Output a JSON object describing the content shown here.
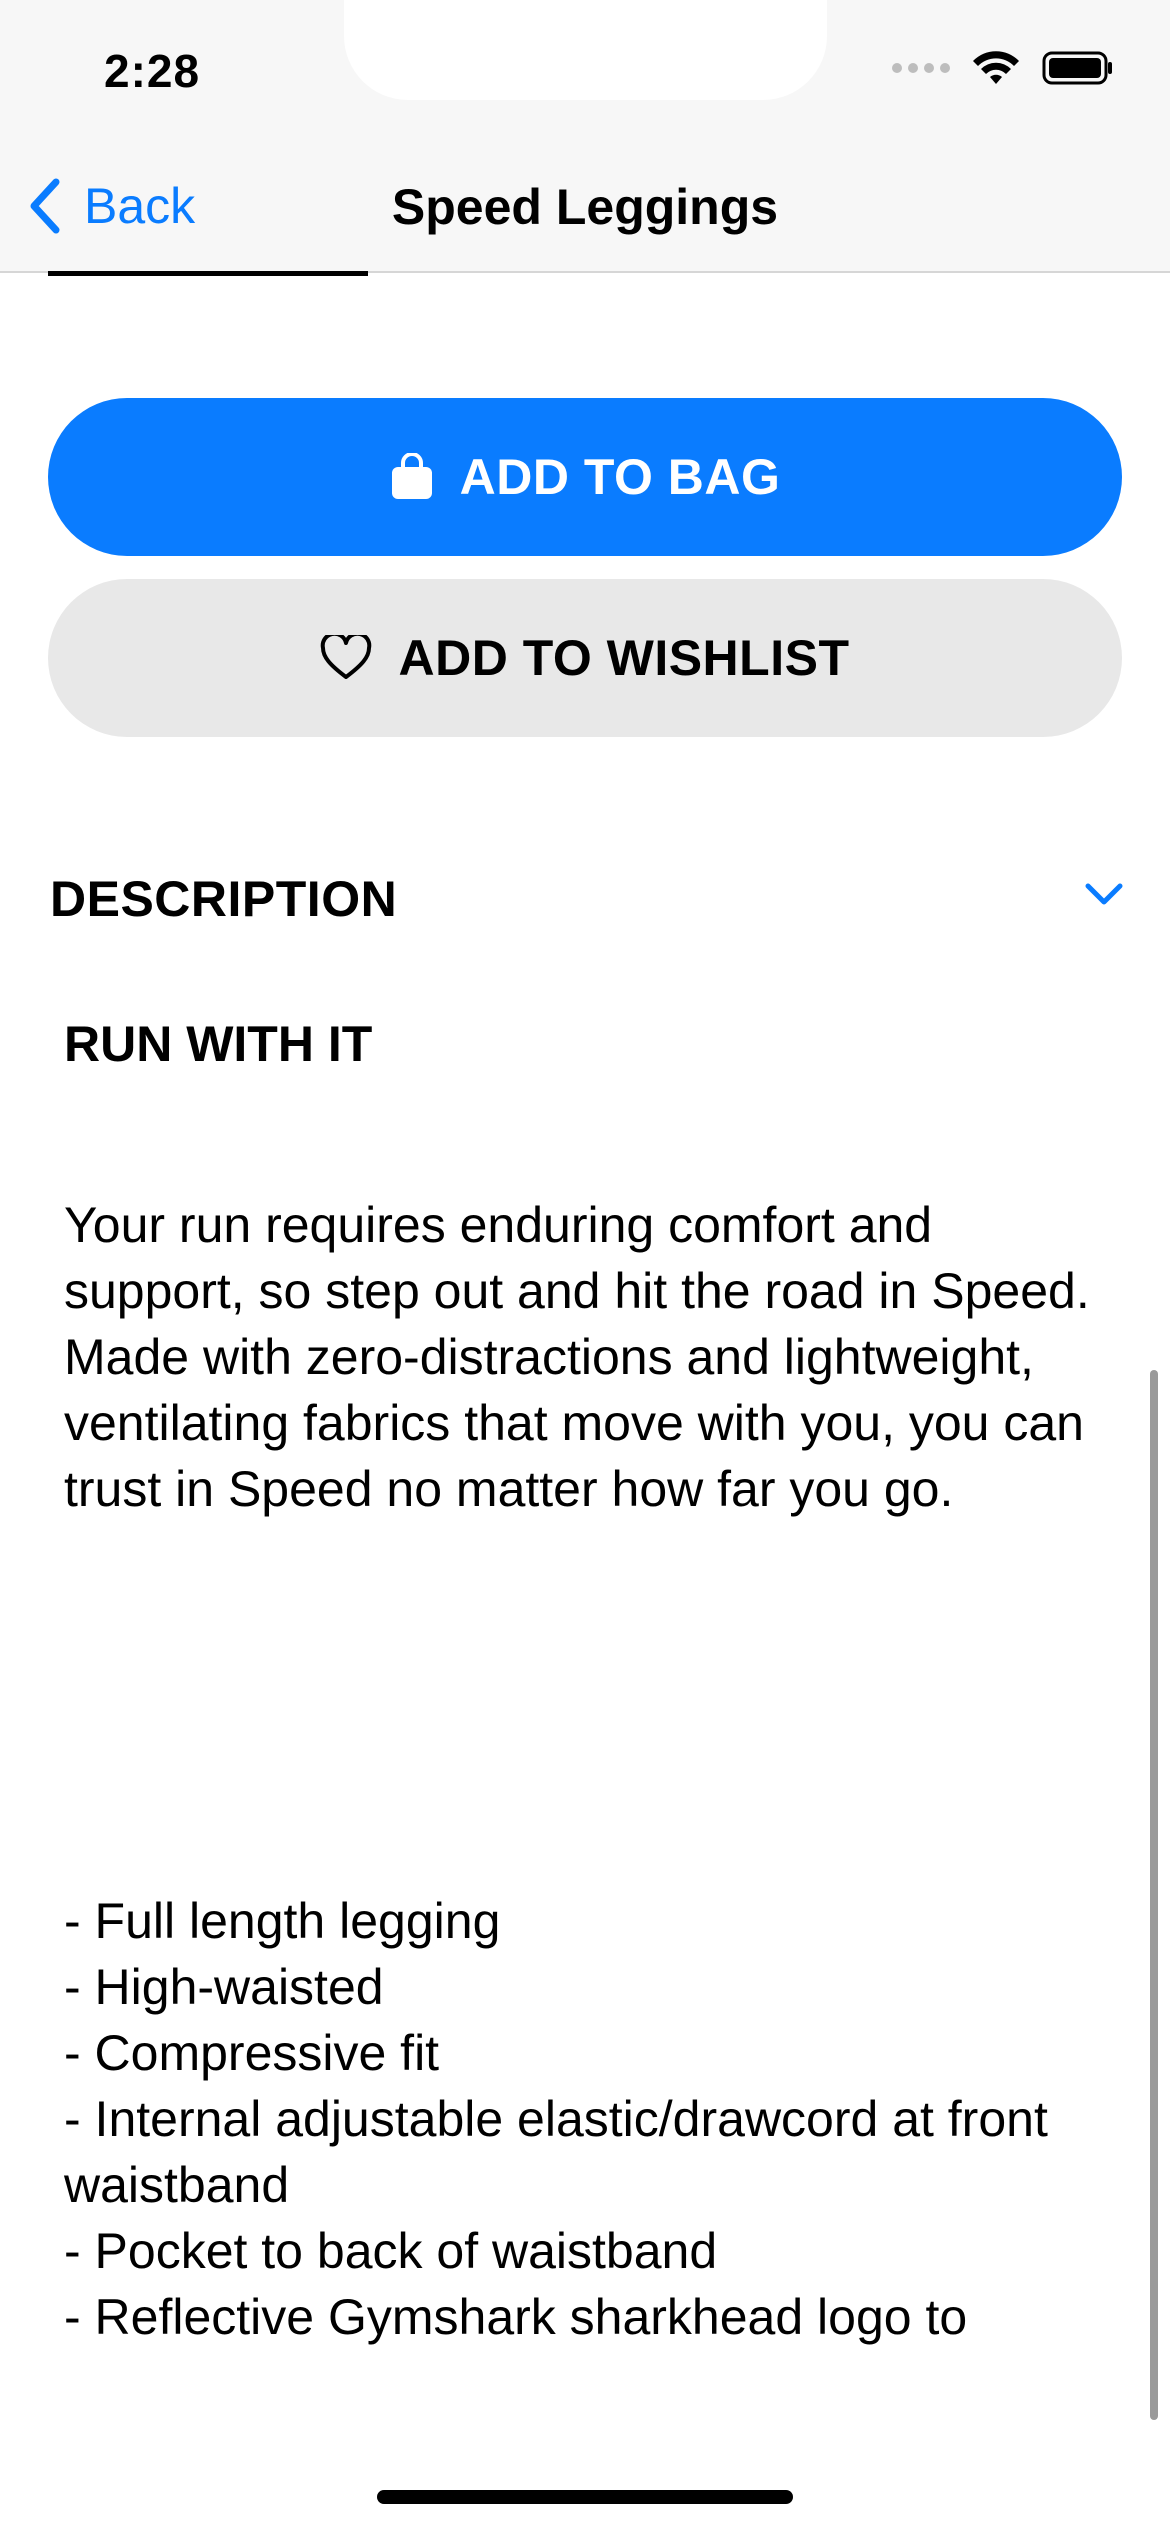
{
  "status_bar": {
    "time": "2:28"
  },
  "nav": {
    "back_label": "Back",
    "title": "Speed Leggings"
  },
  "actions": {
    "add_to_bag": "ADD TO BAG",
    "add_to_wishlist": "ADD TO WISHLIST"
  },
  "description": {
    "header": "DESCRIPTION",
    "subtitle": "RUN WITH IT",
    "body": "Your run requires enduring comfort and support, so step out and hit the road in Speed. Made with zero-distractions and lightweight, ventilating fabrics that move with you, you can trust in Speed no matter how far you go.",
    "features": [
      "Full length legging",
      "High-waisted",
      "Compressive fit",
      "Internal adjustable elastic/drawcord at front waistband",
      "Pocket to back of waistband",
      "Reflective Gymshark sharkhead logo to"
    ]
  },
  "colors": {
    "accent": "#0a7cff",
    "secondary_button": "#e8e8e8",
    "nav_background": "#f7f7f7"
  },
  "icons": {
    "back": "chevron-left-icon",
    "bag": "shopping-bag-icon",
    "wishlist": "heart-icon",
    "expand": "chevron-down-icon"
  }
}
